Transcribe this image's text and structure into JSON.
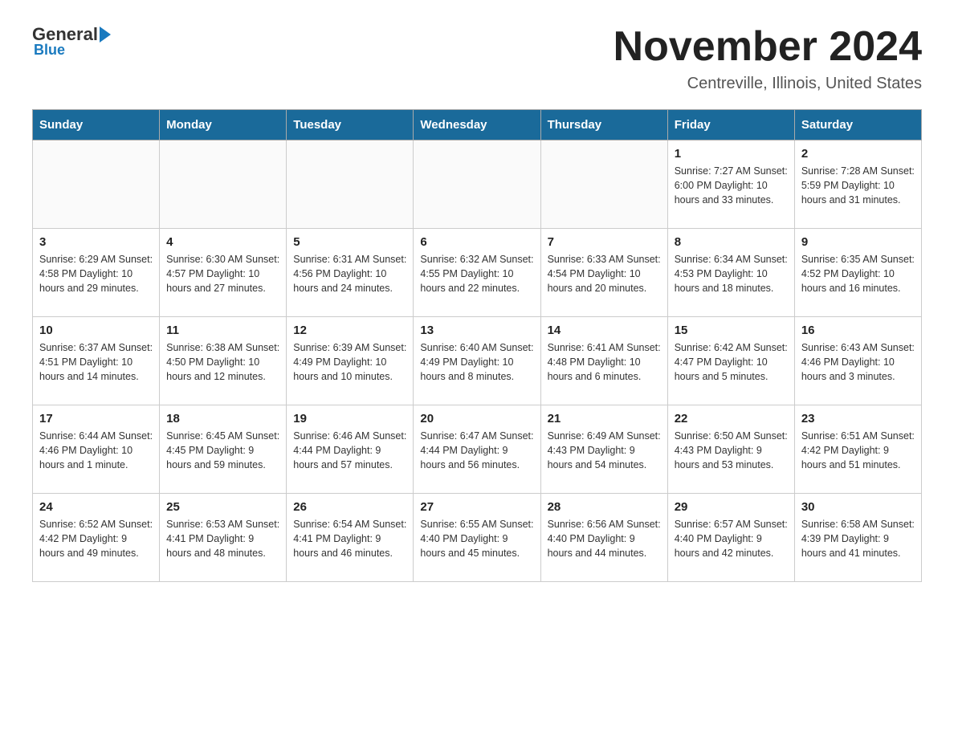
{
  "logo": {
    "text_general": "General",
    "text_blue": "Blue"
  },
  "title": "November 2024",
  "subtitle": "Centreville, Illinois, United States",
  "days_of_week": [
    "Sunday",
    "Monday",
    "Tuesday",
    "Wednesday",
    "Thursday",
    "Friday",
    "Saturday"
  ],
  "weeks": [
    [
      {
        "day": "",
        "info": ""
      },
      {
        "day": "",
        "info": ""
      },
      {
        "day": "",
        "info": ""
      },
      {
        "day": "",
        "info": ""
      },
      {
        "day": "",
        "info": ""
      },
      {
        "day": "1",
        "info": "Sunrise: 7:27 AM\nSunset: 6:00 PM\nDaylight: 10 hours and 33 minutes."
      },
      {
        "day": "2",
        "info": "Sunrise: 7:28 AM\nSunset: 5:59 PM\nDaylight: 10 hours and 31 minutes."
      }
    ],
    [
      {
        "day": "3",
        "info": "Sunrise: 6:29 AM\nSunset: 4:58 PM\nDaylight: 10 hours and 29 minutes."
      },
      {
        "day": "4",
        "info": "Sunrise: 6:30 AM\nSunset: 4:57 PM\nDaylight: 10 hours and 27 minutes."
      },
      {
        "day": "5",
        "info": "Sunrise: 6:31 AM\nSunset: 4:56 PM\nDaylight: 10 hours and 24 minutes."
      },
      {
        "day": "6",
        "info": "Sunrise: 6:32 AM\nSunset: 4:55 PM\nDaylight: 10 hours and 22 minutes."
      },
      {
        "day": "7",
        "info": "Sunrise: 6:33 AM\nSunset: 4:54 PM\nDaylight: 10 hours and 20 minutes."
      },
      {
        "day": "8",
        "info": "Sunrise: 6:34 AM\nSunset: 4:53 PM\nDaylight: 10 hours and 18 minutes."
      },
      {
        "day": "9",
        "info": "Sunrise: 6:35 AM\nSunset: 4:52 PM\nDaylight: 10 hours and 16 minutes."
      }
    ],
    [
      {
        "day": "10",
        "info": "Sunrise: 6:37 AM\nSunset: 4:51 PM\nDaylight: 10 hours and 14 minutes."
      },
      {
        "day": "11",
        "info": "Sunrise: 6:38 AM\nSunset: 4:50 PM\nDaylight: 10 hours and 12 minutes."
      },
      {
        "day": "12",
        "info": "Sunrise: 6:39 AM\nSunset: 4:49 PM\nDaylight: 10 hours and 10 minutes."
      },
      {
        "day": "13",
        "info": "Sunrise: 6:40 AM\nSunset: 4:49 PM\nDaylight: 10 hours and 8 minutes."
      },
      {
        "day": "14",
        "info": "Sunrise: 6:41 AM\nSunset: 4:48 PM\nDaylight: 10 hours and 6 minutes."
      },
      {
        "day": "15",
        "info": "Sunrise: 6:42 AM\nSunset: 4:47 PM\nDaylight: 10 hours and 5 minutes."
      },
      {
        "day": "16",
        "info": "Sunrise: 6:43 AM\nSunset: 4:46 PM\nDaylight: 10 hours and 3 minutes."
      }
    ],
    [
      {
        "day": "17",
        "info": "Sunrise: 6:44 AM\nSunset: 4:46 PM\nDaylight: 10 hours and 1 minute."
      },
      {
        "day": "18",
        "info": "Sunrise: 6:45 AM\nSunset: 4:45 PM\nDaylight: 9 hours and 59 minutes."
      },
      {
        "day": "19",
        "info": "Sunrise: 6:46 AM\nSunset: 4:44 PM\nDaylight: 9 hours and 57 minutes."
      },
      {
        "day": "20",
        "info": "Sunrise: 6:47 AM\nSunset: 4:44 PM\nDaylight: 9 hours and 56 minutes."
      },
      {
        "day": "21",
        "info": "Sunrise: 6:49 AM\nSunset: 4:43 PM\nDaylight: 9 hours and 54 minutes."
      },
      {
        "day": "22",
        "info": "Sunrise: 6:50 AM\nSunset: 4:43 PM\nDaylight: 9 hours and 53 minutes."
      },
      {
        "day": "23",
        "info": "Sunrise: 6:51 AM\nSunset: 4:42 PM\nDaylight: 9 hours and 51 minutes."
      }
    ],
    [
      {
        "day": "24",
        "info": "Sunrise: 6:52 AM\nSunset: 4:42 PM\nDaylight: 9 hours and 49 minutes."
      },
      {
        "day": "25",
        "info": "Sunrise: 6:53 AM\nSunset: 4:41 PM\nDaylight: 9 hours and 48 minutes."
      },
      {
        "day": "26",
        "info": "Sunrise: 6:54 AM\nSunset: 4:41 PM\nDaylight: 9 hours and 46 minutes."
      },
      {
        "day": "27",
        "info": "Sunrise: 6:55 AM\nSunset: 4:40 PM\nDaylight: 9 hours and 45 minutes."
      },
      {
        "day": "28",
        "info": "Sunrise: 6:56 AM\nSunset: 4:40 PM\nDaylight: 9 hours and 44 minutes."
      },
      {
        "day": "29",
        "info": "Sunrise: 6:57 AM\nSunset: 4:40 PM\nDaylight: 9 hours and 42 minutes."
      },
      {
        "day": "30",
        "info": "Sunrise: 6:58 AM\nSunset: 4:39 PM\nDaylight: 9 hours and 41 minutes."
      }
    ]
  ]
}
